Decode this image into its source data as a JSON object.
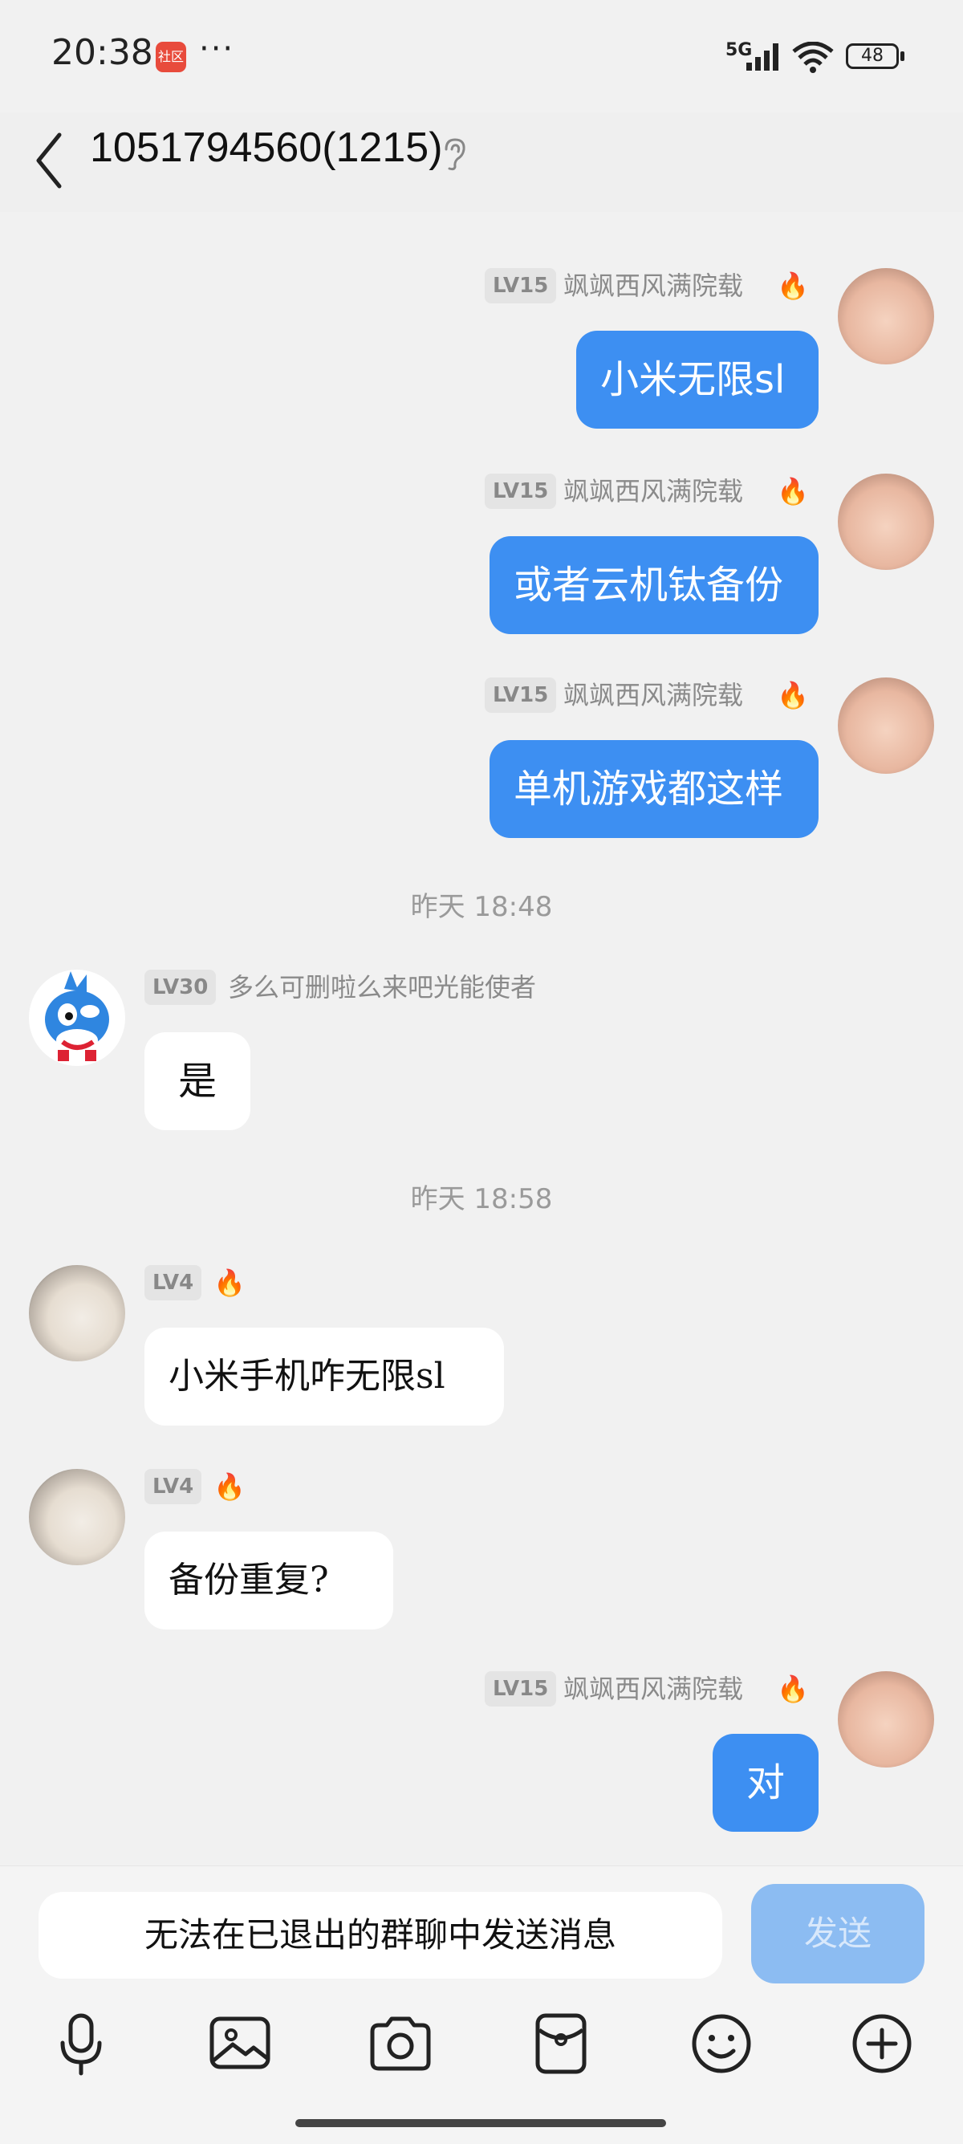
{
  "status": {
    "time": "20:38",
    "app_badge": "社区",
    "more": "···",
    "network": "5G",
    "battery": "48"
  },
  "header": {
    "title": "1051794560(1215)"
  },
  "messages": [
    {
      "level": "LV15",
      "nick": "飒飒西风满院载",
      "text": "小米无限sl"
    },
    {
      "level": "LV15",
      "nick": "飒飒西风满院载",
      "text": "或者云机钛备份"
    },
    {
      "level": "LV15",
      "nick": "飒飒西风满院载",
      "text": "单机游戏都这样"
    },
    {
      "timestamp": "昨天 18:48"
    },
    {
      "level": "LV30",
      "nick": "多么可删啦么来吧光能使者",
      "text": "是"
    },
    {
      "timestamp": "昨天 18:58"
    },
    {
      "level": "LV4",
      "text": "小米手机咋无限sl"
    },
    {
      "level": "LV4",
      "text": "备份重复?"
    },
    {
      "level": "LV15",
      "nick": "飒飒西风满院载",
      "text": "对"
    }
  ],
  "input": {
    "text": "无法在已退出的群聊中发送消息",
    "send_label": "发送"
  },
  "icons": [
    "mic-icon",
    "image-icon",
    "camera-icon",
    "red-packet-icon",
    "emoji-icon",
    "plus-icon"
  ],
  "colors": {
    "bubble_me": "#3d8ff2",
    "bubble_them": "#ffffff",
    "send_disabled": "#8cbcf2",
    "flame": "#f06a2c"
  }
}
